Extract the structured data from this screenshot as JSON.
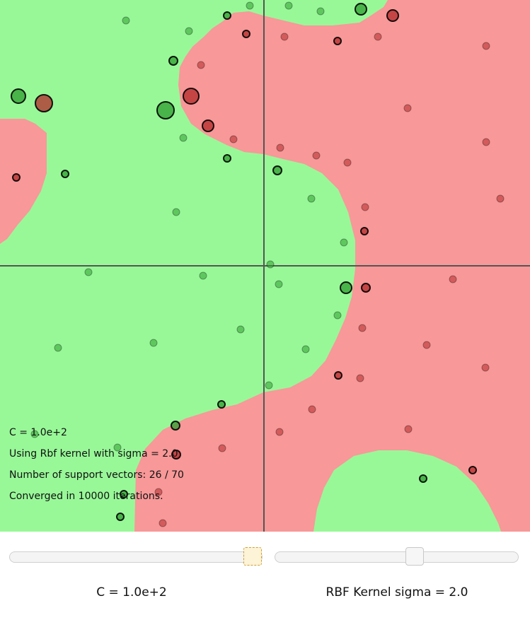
{
  "colors": {
    "class_pos_region": "#98f898",
    "class_neg_region": "#f89898",
    "class_pos_point": "#2f9e2f",
    "class_neg_point": "#b42a2a",
    "axis": "#555555"
  },
  "overlay": {
    "c_line": "C = 1.0e+2",
    "kernel_line": "Using Rbf kernel with sigma = 2.0",
    "sv_line": "Number of support vectors: 26 / 70",
    "iter_line": "Converged in 10000 iterations."
  },
  "controls": {
    "c_label": "C = 1.0e+2",
    "sigma_label": "RBF Kernel sigma = 2.0",
    "c_slider_fraction": 1.0,
    "sigma_slider_fraction": 0.58
  }
}
